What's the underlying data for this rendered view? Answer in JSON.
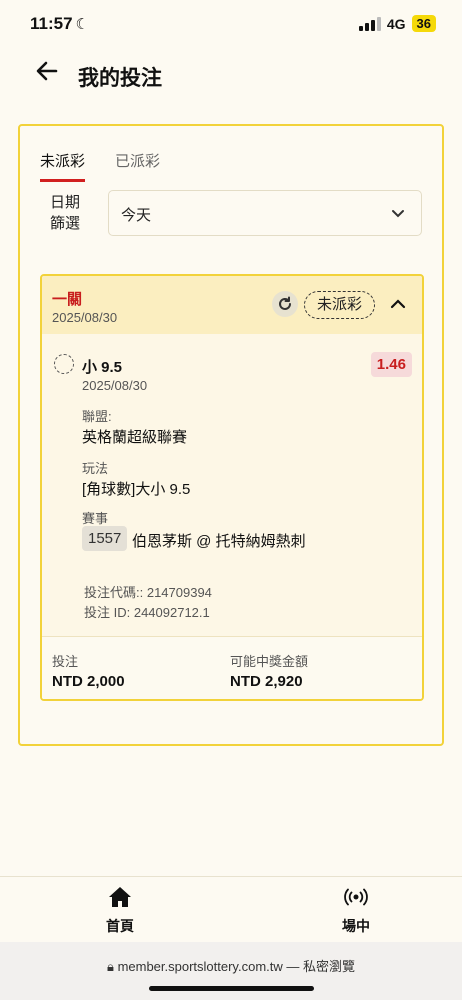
{
  "status": {
    "time": "11:57",
    "network": "4G",
    "battery": "36"
  },
  "header": {
    "title": "我的投注"
  },
  "tabs": [
    {
      "label": "未派彩"
    },
    {
      "label": "已派彩"
    }
  ],
  "filter": {
    "label_line1": "日期",
    "label_line2": "篩選",
    "value": "今天"
  },
  "bet": {
    "type": "一關",
    "date": "2025/08/30",
    "status": "未派彩",
    "selection": "小 9.5",
    "selection_date": "2025/08/30",
    "odds": "1.46",
    "league_label": "聯盟:",
    "league": "英格蘭超級聯賽",
    "market_label": "玩法",
    "market": "[角球數]大小 9.5",
    "event_label": "賽事",
    "event_id": "1557",
    "event": "伯恩茅斯 @ 托特納姆熱刺",
    "code": "投注代碼:: 214709394",
    "bet_id": "投注 ID: 244092712.1",
    "stake_label": "投注",
    "stake": "NTD 2,000",
    "payout_label": "可能中獎金額",
    "payout": "NTD 2,920"
  },
  "nav": [
    {
      "label": "首頁",
      "icon": "home-icon"
    },
    {
      "label": "場中",
      "icon": "live-broadcast-icon"
    }
  ],
  "browser": {
    "url": "member.sportslottery.com.tw — 私密瀏覽"
  },
  "colors": {
    "accent_red": "#d11f1f",
    "card_border": "#f2d23a",
    "card_header": "#fbeec0",
    "background": "#fdfaf2"
  }
}
